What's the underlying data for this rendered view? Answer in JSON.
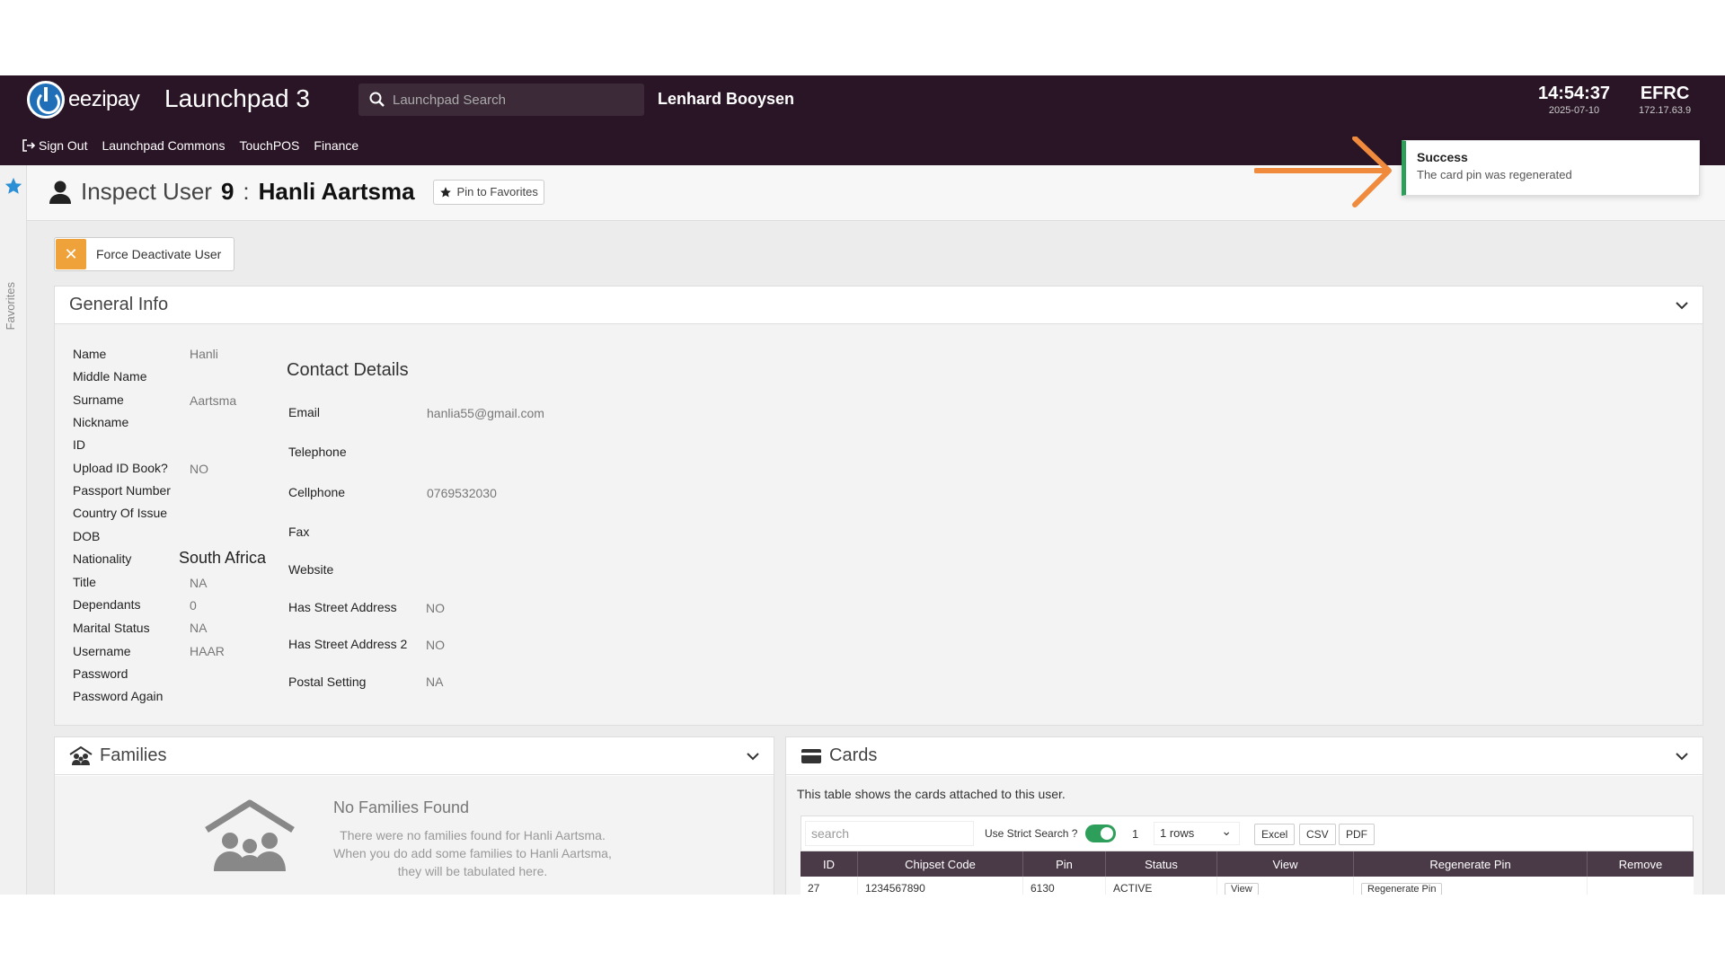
{
  "topbar": {
    "logo_text": "eezipay",
    "app_title": "Launchpad 3",
    "search_placeholder": "Launchpad Search",
    "user_name": "Lenhard Booysen",
    "time": "14:54:37",
    "date": "2025-07-10",
    "server_name": "EFRC",
    "server_ip": "172.17.63.9"
  },
  "nav": {
    "sign_out": "Sign Out",
    "items": [
      "Launchpad Commons",
      "TouchPOS",
      "Finance"
    ]
  },
  "favorites": {
    "label": "Favorites"
  },
  "header": {
    "prefix": "Inspect User",
    "user_id": "9",
    "separator": ":",
    "user_full_name": "Hanli Aartsma",
    "pin_label": "Pin to Favorites"
  },
  "toast": {
    "title": "Success",
    "message": "The card pin was regenerated",
    "accent": "#2e9e5b"
  },
  "actions": {
    "force_deactivate": "Force Deactivate User"
  },
  "general_info": {
    "title": "General Info",
    "fields": [
      {
        "label": "Name",
        "value": "Hanli"
      },
      {
        "label": "Middle Name",
        "value": ""
      },
      {
        "label": "Surname",
        "value": "Aartsma"
      },
      {
        "label": "Nickname",
        "value": ""
      },
      {
        "label": "ID",
        "value": ""
      },
      {
        "label": "Upload ID Book?",
        "value": "NO"
      },
      {
        "label": "Passport Number",
        "value": ""
      },
      {
        "label": "Country Of Issue",
        "value": ""
      },
      {
        "label": "DOB",
        "value": ""
      },
      {
        "label": "Nationality",
        "value": "South Africa"
      },
      {
        "label": "Title",
        "value": "NA"
      },
      {
        "label": "Dependants",
        "value": "0"
      },
      {
        "label": "Marital Status",
        "value": "NA"
      },
      {
        "label": "Username",
        "value": "HAAR"
      },
      {
        "label": "Password",
        "value": ""
      },
      {
        "label": "Password Again",
        "value": ""
      }
    ],
    "contact_title": "Contact Details",
    "contact": [
      {
        "label": "Email",
        "value": "hanlia55@gmail.com"
      },
      {
        "label": "Telephone",
        "value": ""
      },
      {
        "label": "Cellphone",
        "value": "0769532030"
      },
      {
        "label": "Fax",
        "value": ""
      },
      {
        "label": "Website",
        "value": ""
      },
      {
        "label": "Has Street Address",
        "value": "NO"
      },
      {
        "label": "Has Street Address 2",
        "value": "NO"
      },
      {
        "label": "Postal Setting",
        "value": "NA"
      }
    ]
  },
  "families": {
    "title": "Families",
    "empty_title": "No Families Found",
    "empty_line1": "There were no families found for Hanli Aartsma.",
    "empty_line2": "When you do add some families to Hanli Aartsma,",
    "empty_line3": "they will be tabulated here."
  },
  "cards": {
    "title": "Cards",
    "note": "This table shows the cards attached to this user.",
    "search_placeholder": "search",
    "strict_label": "Use Strict Search ?",
    "page": "1",
    "rows_label": "1 rows",
    "export": [
      "Excel",
      "CSV",
      "PDF"
    ],
    "columns": [
      "ID",
      "Chipset Code",
      "Pin",
      "Status",
      "View",
      "Regenerate Pin",
      "Remove"
    ],
    "row": {
      "id": "27",
      "chipset": "1234567890",
      "pin": "6130",
      "status": "ACTIVE",
      "view": "View",
      "regen": "Regenerate Pin"
    }
  }
}
